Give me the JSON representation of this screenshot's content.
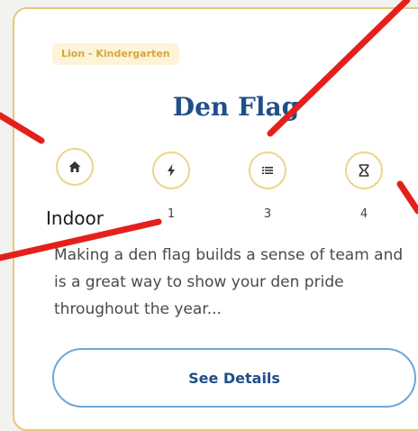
{
  "card": {
    "badge": "Lion - Kindergarten",
    "title": "Den Flag",
    "stats": [
      {
        "icon": "home-icon",
        "label": "Indoor"
      },
      {
        "icon": "lightning-icon",
        "label": "1"
      },
      {
        "icon": "list-icon",
        "label": "3"
      },
      {
        "icon": "hourglass-icon",
        "label": "4"
      }
    ],
    "description": "Making a den flag builds a sense of team and is a great way to show your den pride throughout the year...",
    "details_button": "See Details"
  },
  "colors": {
    "border": "#e8c77a",
    "badge_bg": "#fdf3d6",
    "badge_text": "#d6a640",
    "title": "#1f4f8a",
    "button_border": "#6ea6d8",
    "annotation_line": "#e3201b"
  }
}
